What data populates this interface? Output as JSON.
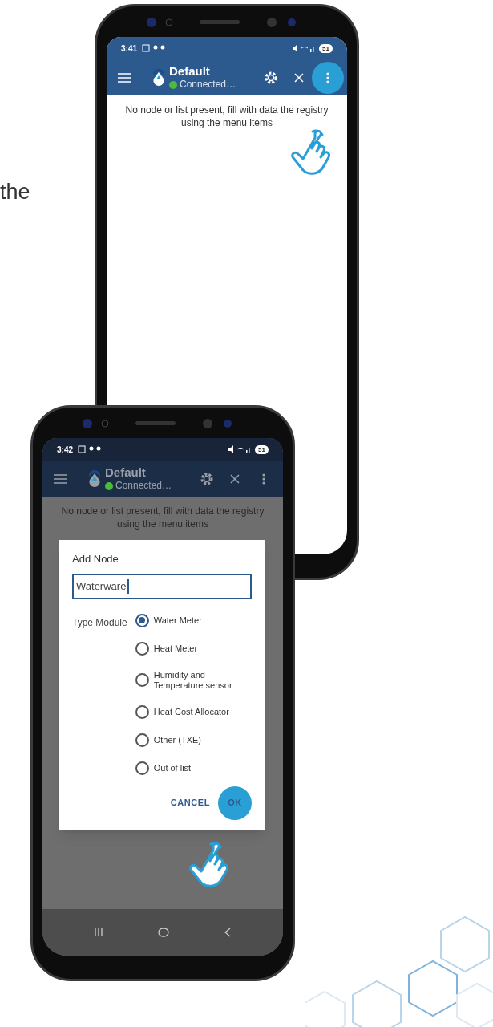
{
  "caption_fragment": "the",
  "phones": [
    {
      "status_bar": {
        "time": "3:41",
        "battery": "51"
      },
      "app_bar": {
        "title": "Default",
        "connection": "Connected…"
      },
      "message": "No node or list present, fill with data the registry using the menu items",
      "menu_tapped": true
    },
    {
      "status_bar": {
        "time": "3:42",
        "battery": "51"
      },
      "app_bar": {
        "title": "Default",
        "connection": "Connected…"
      },
      "message": "No node or list present, fill with data the registry using the menu items",
      "menu_tapped": false,
      "nav_bar": true,
      "dialog": {
        "title": "Add Node",
        "field_value": "Waterware",
        "group_label": "Type Module",
        "options": [
          {
            "label": "Water Meter",
            "selected": true
          },
          {
            "label": "Heat Meter",
            "selected": false
          },
          {
            "label": "Humidity and Temperature sensor",
            "selected": false
          },
          {
            "label": "Heat Cost Allocator",
            "selected": false
          },
          {
            "label": "Other (TXE)",
            "selected": false
          },
          {
            "label": "Out of list",
            "selected": false
          }
        ],
        "buttons": [
          "CANCEL",
          "OK"
        ],
        "ok_tapped": true
      }
    }
  ]
}
